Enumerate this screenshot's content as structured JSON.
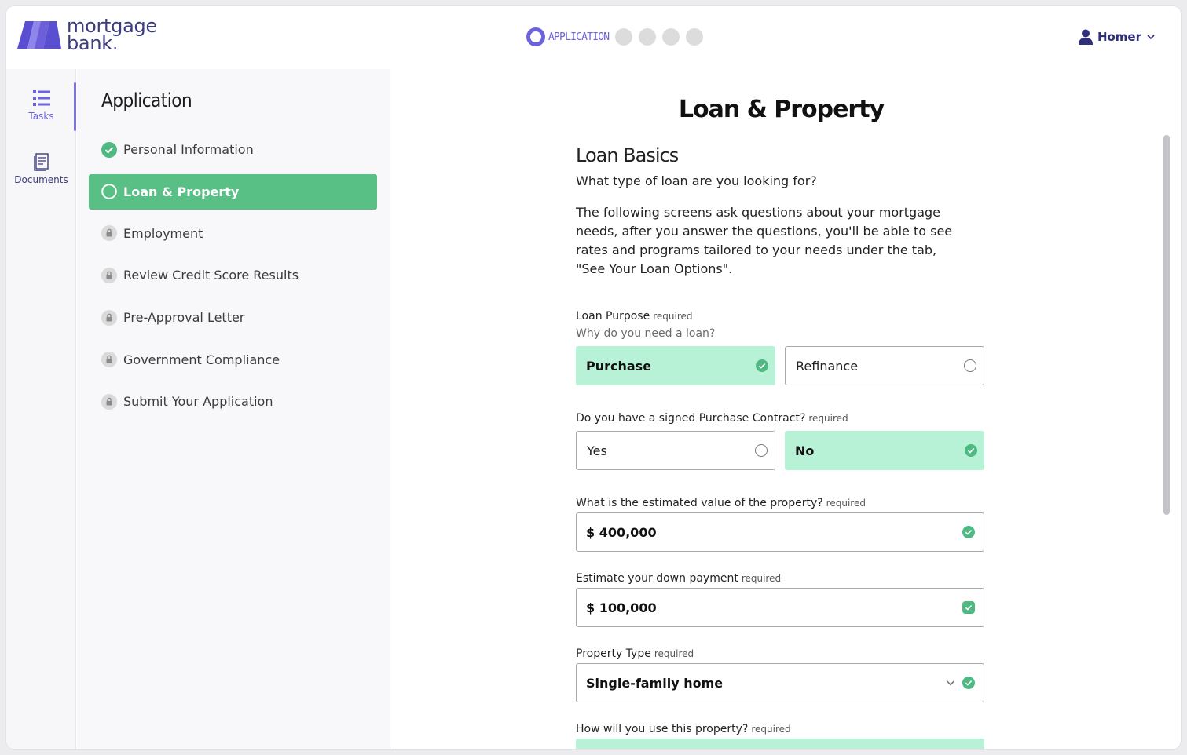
{
  "brand": {
    "line1": "mortgage",
    "line2": "bank",
    "dot": ".",
    "mark_color": "#6d5fd9",
    "text_color": "#3c3c7e"
  },
  "progress": {
    "active_label": "APPLICATION",
    "inactive_steps": 4
  },
  "user": {
    "name": "Homer"
  },
  "rail": {
    "tasks_label": "Tasks",
    "documents_label": "Documents"
  },
  "sidebar": {
    "title": "Application",
    "items": [
      {
        "label": "Personal Information",
        "status": "complete"
      },
      {
        "label": "Loan & Property",
        "status": "active"
      },
      {
        "label": "Employment",
        "status": "locked"
      },
      {
        "label": "Review Credit Score Results",
        "status": "locked"
      },
      {
        "label": "Pre-Approval Letter",
        "status": "locked"
      },
      {
        "label": "Government Compliance",
        "status": "locked"
      },
      {
        "label": "Submit Your Application",
        "status": "locked"
      }
    ]
  },
  "main": {
    "title": "Loan & Property",
    "section_title": "Loan Basics",
    "section_sub": "What type of loan are you looking for?",
    "intro": "The following screens ask questions about your mortgage needs, after you answer the questions, you'll be able to see rates and programs tailored to your needs under the tab, \"See Your Loan Options\".",
    "required_label": "required",
    "loan_purpose": {
      "label": "Loan Purpose",
      "hint": "Why do you need a loan?",
      "options": [
        "Purchase",
        "Refinance"
      ],
      "selected": "Purchase"
    },
    "contract": {
      "label": "Do you have a signed Purchase Contract?",
      "options": [
        "Yes",
        "No"
      ],
      "selected": "No"
    },
    "property_value": {
      "label": "What is the estimated value of the property?",
      "value": "$ 400,000"
    },
    "down_payment": {
      "label": "Estimate your down payment",
      "value": "$ 100,000"
    },
    "property_type": {
      "label": "Property Type",
      "value": "Single-family home"
    },
    "usage": {
      "label": "How will you use this property?"
    }
  },
  "colors": {
    "accent": "#6c63dc",
    "success": "#58bf85",
    "selected_bg": "#b8f2d6",
    "check": "#4fb982"
  }
}
